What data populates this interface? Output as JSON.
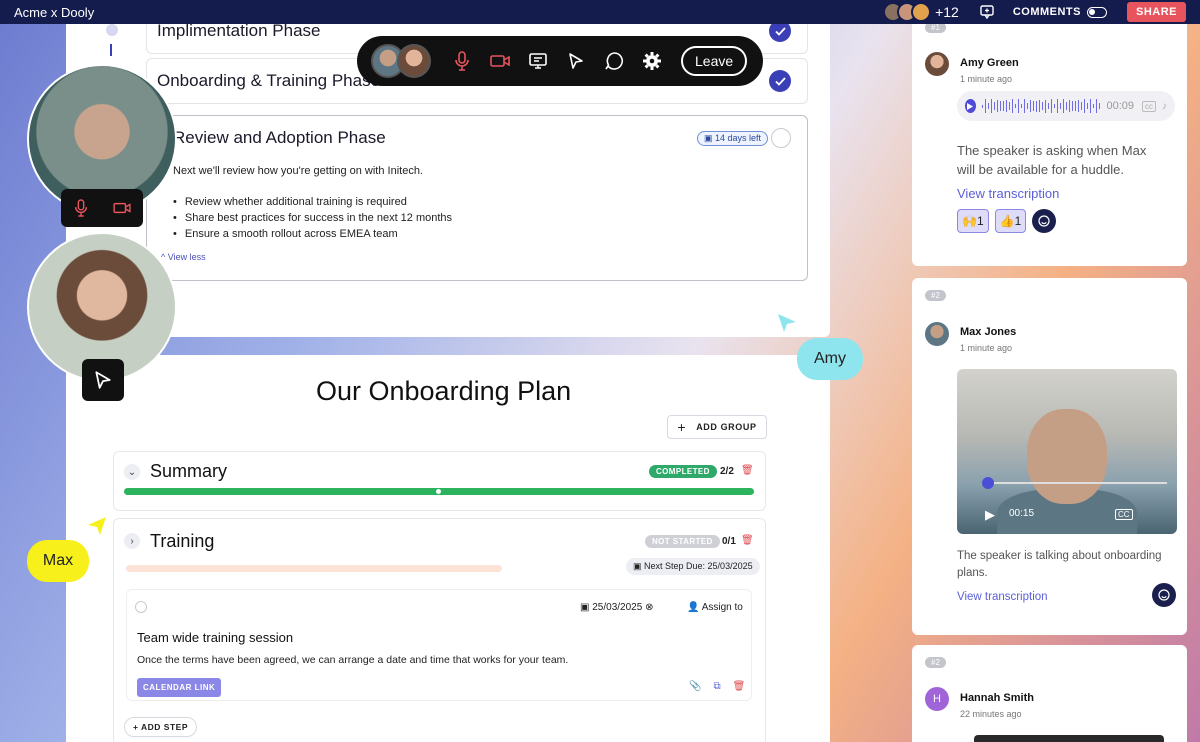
{
  "topbar": {
    "title": "Acme x Dooly",
    "participant_extra": "+12",
    "comments_label": "COMMENTS",
    "share_label": "SHARE",
    "colors": {
      "bg": "#141b4d",
      "share": "#e8545d"
    }
  },
  "phases": {
    "implementation": "Implimentation Phase",
    "onboarding": "Onboarding & Training Phase",
    "open": {
      "title": "Review and Adoption Phase",
      "days_left": "14 days left",
      "description": "Next we'll review how you're getting on with Initech.",
      "bullets": [
        "Review whether additional training is required",
        "Share best practices for success in the next 12 months",
        "Ensure a smooth rollout across EMEA team"
      ],
      "view_less": "View less"
    }
  },
  "call": {
    "leave_label": "Leave"
  },
  "cursors": {
    "amy": "Amy",
    "max": "Max"
  },
  "plan": {
    "title": "Our Onboarding Plan",
    "add_group": "ADD GROUP",
    "groups": [
      {
        "title": "Summary",
        "status": "COMPLETED",
        "count": "2/2",
        "progress": 1.0
      },
      {
        "title": "Training",
        "status": "NOT STARTED",
        "count": "0/1",
        "progress": 0.0,
        "next_due": "Next Step Due: 25/03/2025"
      }
    ],
    "step": {
      "date": "25/03/2025",
      "assign": "Assign to",
      "title": "Team wide training session",
      "description": "Once the terms have been agreed, we can arrange a date and time that works for your team.",
      "calendar_link": "CALENDAR LINK"
    },
    "add_step": "ADD STEP"
  },
  "comments": [
    {
      "num": "#1",
      "name": "Amy Green",
      "time": "1 minute ago",
      "audio_time": "00:09",
      "text": "The speaker is asking when Max will be available for a huddle.",
      "link": "View transcription",
      "reactions": [
        {
          "emoji": "🙌",
          "count": "1"
        },
        {
          "emoji": "👍",
          "count": "1"
        }
      ]
    },
    {
      "num": "#2",
      "name": "Max Jones",
      "time": "1 minute ago",
      "video_time": "00:15",
      "text": "The speaker is talking about onboarding plans.",
      "link": "View transcription"
    },
    {
      "num": "#2",
      "name": "Hannah Smith",
      "time": "22 minutes ago",
      "initial": "H"
    }
  ]
}
